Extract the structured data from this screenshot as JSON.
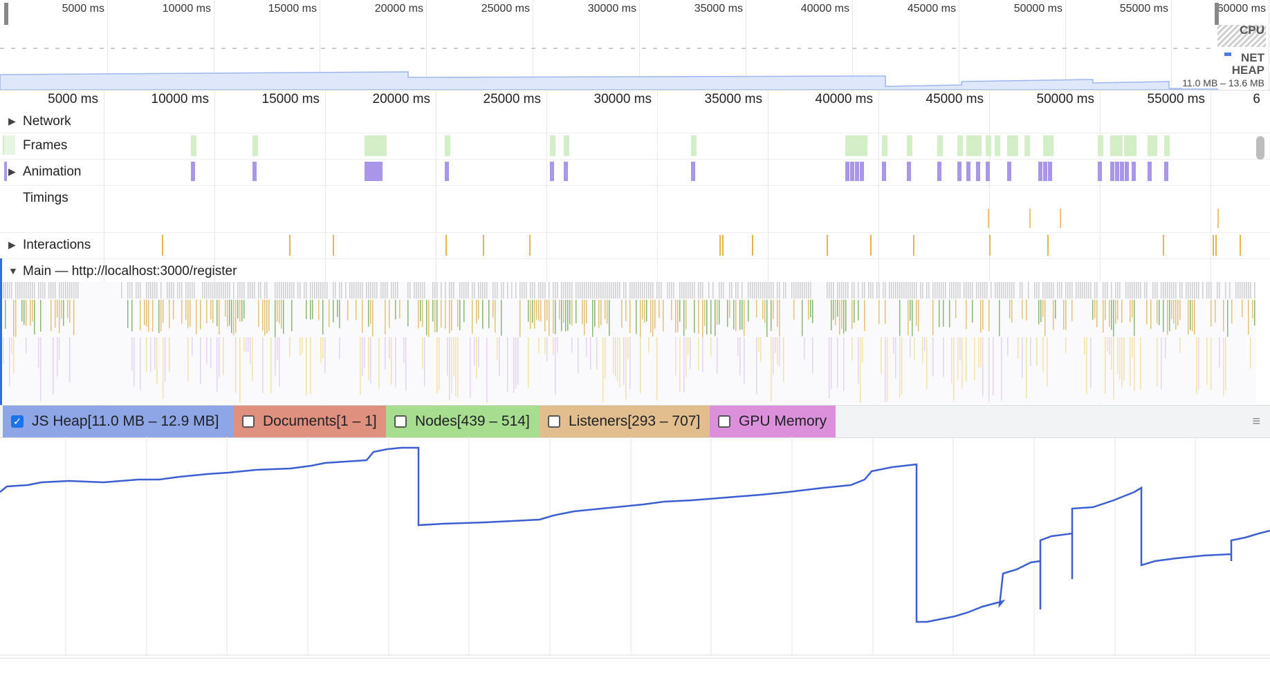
{
  "overview": {
    "tick_labels": [
      "5000 ms",
      "10000 ms",
      "15000 ms",
      "20000 ms",
      "25000 ms",
      "30000 ms",
      "35000 ms",
      "40000 ms",
      "45000 ms",
      "50000 ms",
      "55000 ms",
      "60000 ms"
    ],
    "labels": {
      "cpu": "CPU",
      "net": "NET",
      "heap": "HEAP"
    },
    "heap_range": "11.0 MB – 13.6 MB"
  },
  "ruler": {
    "labels": [
      "5000 ms",
      "10000 ms",
      "15000 ms",
      "20000 ms",
      "25000 ms",
      "30000 ms",
      "35000 ms",
      "40000 ms",
      "45000 ms",
      "50000 ms",
      "55000 ms",
      "6"
    ]
  },
  "tracks": {
    "network": "Network",
    "frames": "Frames",
    "animation": "Animation",
    "timings": "Timings",
    "interactions": "Interactions",
    "main": "Main — http://localhost:3000/register"
  },
  "counters": [
    {
      "label": "JS Heap[11.0 MB – 12.9 MB]",
      "checked": true,
      "color": "#8ea6e6"
    },
    {
      "label": "Documents[1 – 1]",
      "checked": false,
      "color": "#e0907f"
    },
    {
      "label": "Nodes[439 – 514]",
      "checked": false,
      "color": "#a6dd8f"
    },
    {
      "label": "Listeners[293 – 707]",
      "checked": false,
      "color": "#e2bd8e"
    },
    {
      "label": "GPU Memory",
      "checked": false,
      "color": "#dc90dc"
    }
  ],
  "colors": {
    "heap_line": "#3b5fd0",
    "frames": "#d4efc7",
    "animation": "#a996e8",
    "interactions": "#e8b347",
    "timings": "#f0c07a",
    "accent": "#2f6fd8"
  }
}
